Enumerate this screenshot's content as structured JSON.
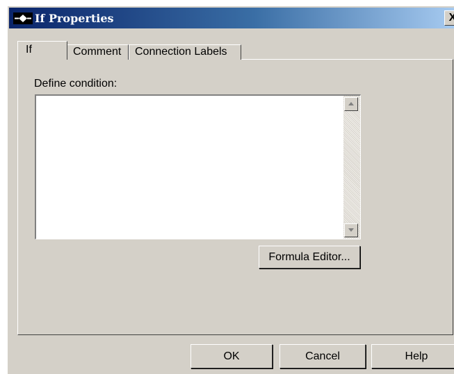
{
  "window": {
    "title": "If Properties",
    "close_label": "X"
  },
  "tabs": [
    {
      "label": "If",
      "selected": true
    },
    {
      "label": "Comment",
      "selected": false
    },
    {
      "label": "Connection Labels",
      "selected": false
    }
  ],
  "condition": {
    "label": "Define condition:",
    "value": ""
  },
  "buttons": {
    "formula_editor": "Formula Editor...",
    "ok": "OK",
    "cancel": "Cancel",
    "help": "Help"
  },
  "colors": {
    "face": "#d4d0c8",
    "title_start": "#0a246a",
    "title_end": "#a6caf0"
  },
  "icons": {
    "title": "diamond-flow-icon",
    "scroll_up": "arrow-up-icon",
    "scroll_down": "arrow-down-icon"
  }
}
